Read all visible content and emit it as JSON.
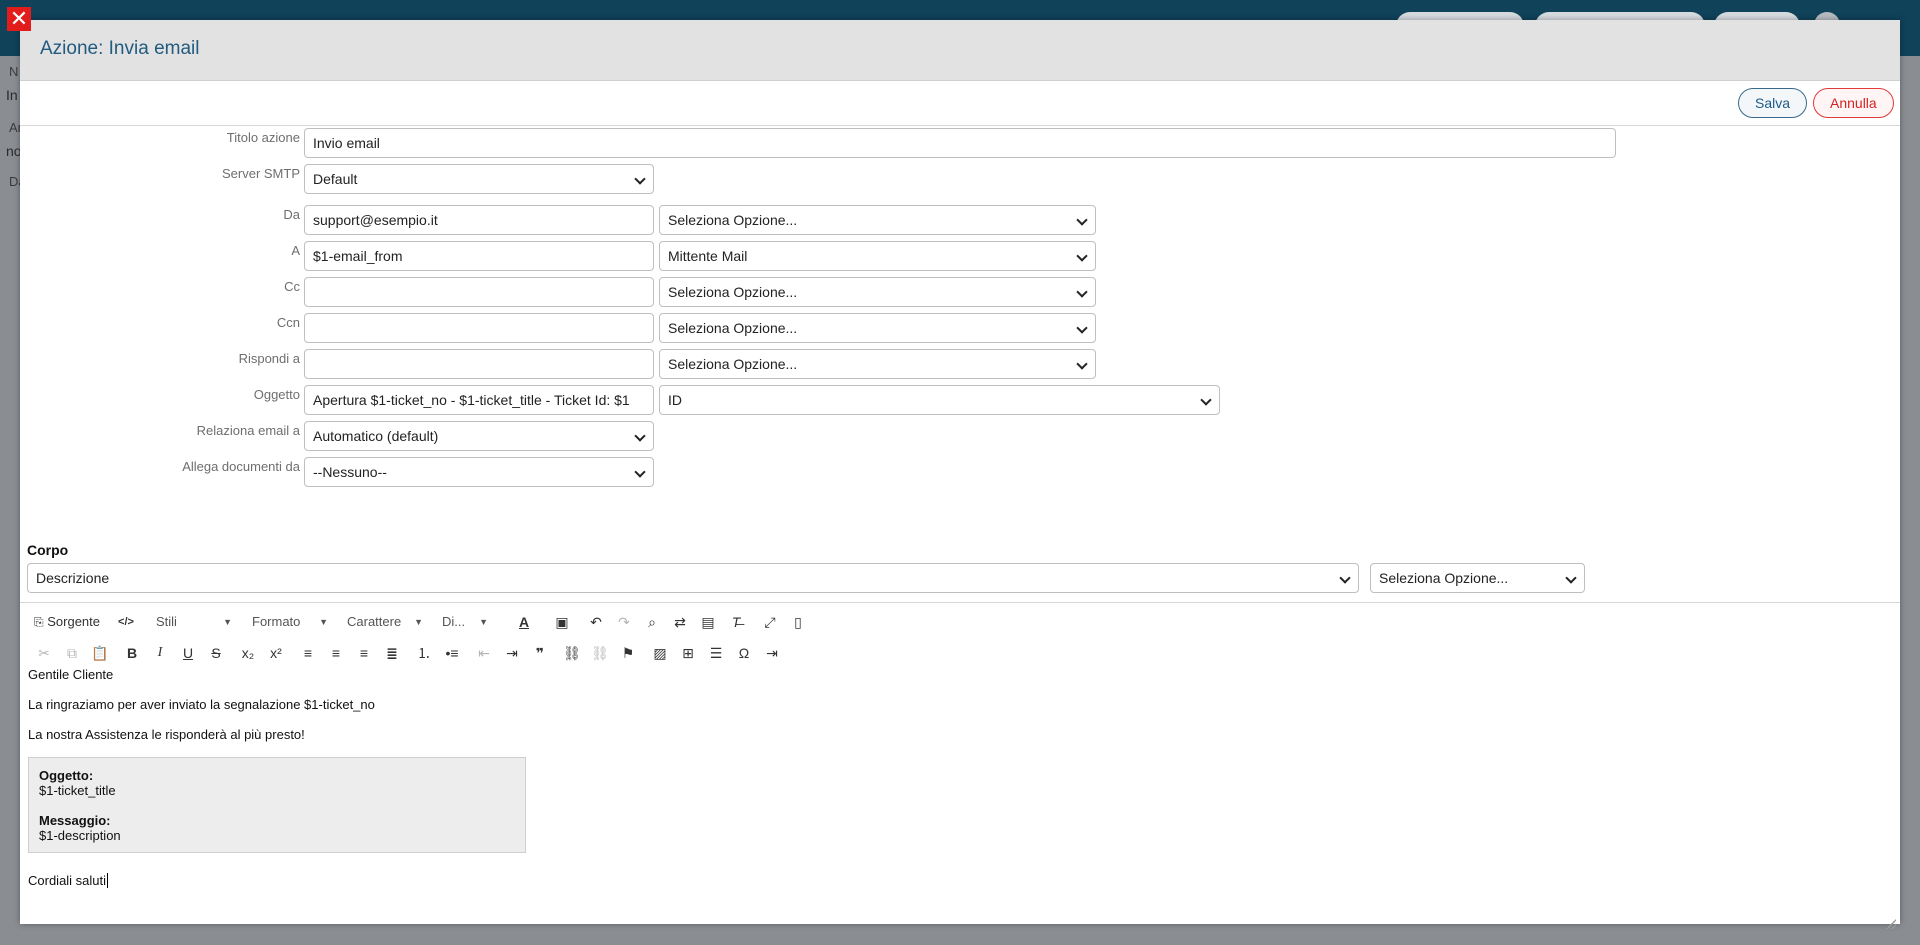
{
  "background": {
    "fragments": [
      "N",
      "In",
      "Ar",
      "no",
      "Da"
    ]
  },
  "modal": {
    "title": "Azione: Invia email",
    "save_label": "Salva",
    "cancel_label": "Annulla"
  },
  "form": {
    "titolo_label": "Titolo azione",
    "titolo_value": "Invio email",
    "smtp_label": "Server SMTP",
    "smtp_value": "Default",
    "da_label": "Da",
    "da_value": "support@esempio.it",
    "da_option": "Seleziona Opzione...",
    "a_label": "A",
    "a_value": "$1-email_from",
    "a_option": "Mittente Mail",
    "cc_label": "Cc",
    "cc_value": "",
    "cc_option": "Seleziona Opzione...",
    "ccn_label": "Ccn",
    "ccn_value": "",
    "ccn_option": "Seleziona Opzione...",
    "rispondi_label": "Rispondi a",
    "rispondi_value": "",
    "rispondi_option": "Seleziona Opzione...",
    "oggetto_label": "Oggetto",
    "oggetto_value": "Apertura  $1-ticket_no - $1-ticket_title - Ticket Id:  $1",
    "oggetto_option": "ID",
    "relaziona_label": "Relaziona email a",
    "relaziona_value": "Automatico (default)",
    "allega_label": "Allega documenti da",
    "allega_value": "--Nessuno--"
  },
  "corpo": {
    "label": "Corpo",
    "field_select": "Descrizione",
    "option_select": "Seleziona Opzione..."
  },
  "toolbar": {
    "source_label": "Sorgente",
    "styles_label": "Stili",
    "format_label": "Formato",
    "font_label": "Carattere",
    "size_label": "Di..."
  },
  "editor": {
    "greeting": "Gentile Cliente",
    "line1": "La ringraziamo per aver inviato la segnalazione $1-ticket_no",
    "line2": "La nostra Assistenza le risponderà al più presto!",
    "quote_subject_label": "Oggetto:",
    "quote_subject_value": "$1-ticket_title",
    "quote_message_label": "Messaggio:",
    "quote_message_value": "$1-description",
    "closing": "Cordiali saluti"
  }
}
